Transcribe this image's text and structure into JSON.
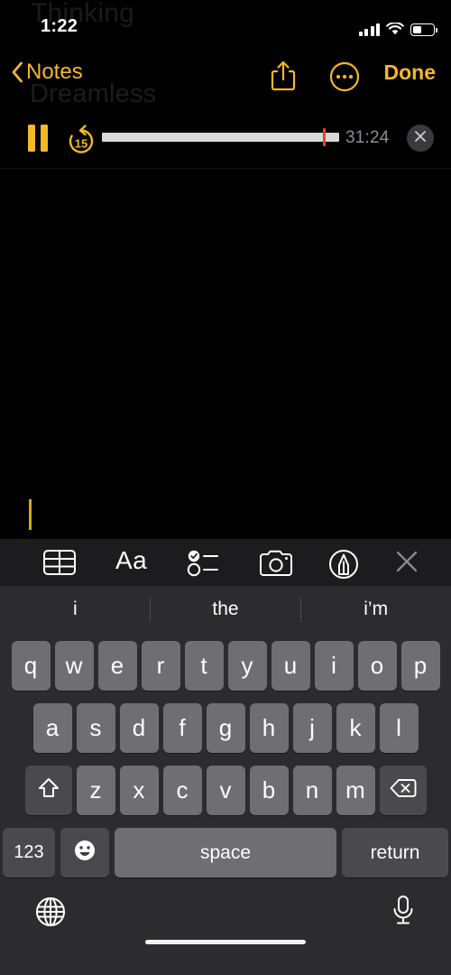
{
  "theme": {
    "background": "#000000",
    "accent": "#f5b829",
    "keyboard_bg": "#2c2c2e",
    "key_bg": "#6e6e73",
    "key_dark_bg": "#4a4a4e",
    "toolbar_bg": "#1c1c1e",
    "playhead": "#e8432a",
    "muted_text": "#8e8e93"
  },
  "ghost_note": {
    "title": "Thinking",
    "subtitle": "Dreamless"
  },
  "status_bar": {
    "time": "1:22",
    "cellular": "signal-bars-4",
    "wifi": "wifi-icon",
    "battery_percent": 45
  },
  "nav_bar": {
    "back_label": "Notes",
    "back_icon": "chevron-left-icon",
    "share_icon": "share-icon",
    "more_icon": "ellipsis-circle-icon",
    "done_label": "Done"
  },
  "audio_player": {
    "pause_icon": "pause-icon",
    "rewind_label": "15",
    "rewind_icon": "rewind-15-icon",
    "progress_percent": 93,
    "elapsed_time": "31:24",
    "close_icon": "close-icon"
  },
  "note_editor": {
    "body_text": "",
    "caret_visible": true
  },
  "format_toolbar": {
    "items": [
      {
        "name": "table-icon",
        "label": "Table"
      },
      {
        "name": "text-format-icon",
        "label": "Aa"
      },
      {
        "name": "checklist-icon",
        "label": "Checklist"
      },
      {
        "name": "camera-icon",
        "label": "Camera"
      },
      {
        "name": "markup-pen-icon",
        "label": "Markup"
      },
      {
        "name": "close-icon",
        "label": "Close"
      }
    ],
    "aa_label": "Aa"
  },
  "keyboard": {
    "predictions": [
      "i",
      "the",
      "i’m"
    ],
    "row1": [
      "q",
      "w",
      "e",
      "r",
      "t",
      "y",
      "u",
      "i",
      "o",
      "p"
    ],
    "row2": [
      "a",
      "s",
      "d",
      "f",
      "g",
      "h",
      "j",
      "k",
      "l"
    ],
    "row3": [
      "z",
      "x",
      "c",
      "v",
      "b",
      "n",
      "m"
    ],
    "shift_icon": "shift-icon",
    "delete_icon": "backspace-icon",
    "numbers_label": "123",
    "emoji_icon": "emoji-icon",
    "space_label": "space",
    "return_label": "return",
    "globe_icon": "globe-icon",
    "mic_icon": "microphone-icon"
  }
}
